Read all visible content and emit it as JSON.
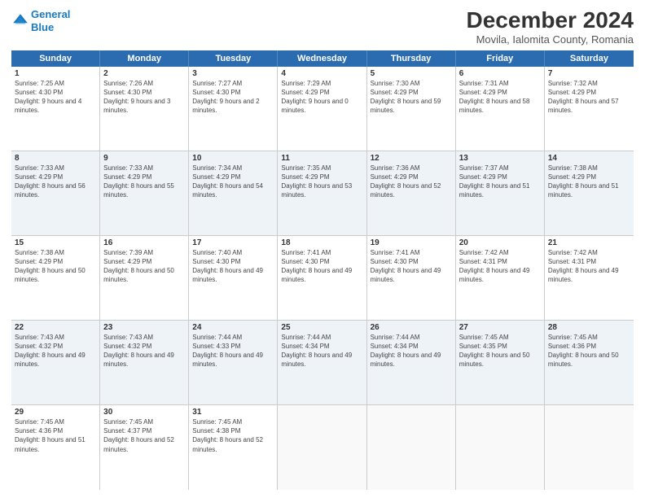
{
  "logo": {
    "line1": "General",
    "line2": "Blue"
  },
  "title": "December 2024",
  "subtitle": "Movila, Ialomita County, Romania",
  "days_of_week": [
    "Sunday",
    "Monday",
    "Tuesday",
    "Wednesday",
    "Thursday",
    "Friday",
    "Saturday"
  ],
  "weeks": [
    [
      {
        "day": "1",
        "sunrise": "Sunrise: 7:25 AM",
        "sunset": "Sunset: 4:30 PM",
        "daylight": "Daylight: 9 hours and 4 minutes."
      },
      {
        "day": "2",
        "sunrise": "Sunrise: 7:26 AM",
        "sunset": "Sunset: 4:30 PM",
        "daylight": "Daylight: 9 hours and 3 minutes."
      },
      {
        "day": "3",
        "sunrise": "Sunrise: 7:27 AM",
        "sunset": "Sunset: 4:30 PM",
        "daylight": "Daylight: 9 hours and 2 minutes."
      },
      {
        "day": "4",
        "sunrise": "Sunrise: 7:29 AM",
        "sunset": "Sunset: 4:29 PM",
        "daylight": "Daylight: 9 hours and 0 minutes."
      },
      {
        "day": "5",
        "sunrise": "Sunrise: 7:30 AM",
        "sunset": "Sunset: 4:29 PM",
        "daylight": "Daylight: 8 hours and 59 minutes."
      },
      {
        "day": "6",
        "sunrise": "Sunrise: 7:31 AM",
        "sunset": "Sunset: 4:29 PM",
        "daylight": "Daylight: 8 hours and 58 minutes."
      },
      {
        "day": "7",
        "sunrise": "Sunrise: 7:32 AM",
        "sunset": "Sunset: 4:29 PM",
        "daylight": "Daylight: 8 hours and 57 minutes."
      }
    ],
    [
      {
        "day": "8",
        "sunrise": "Sunrise: 7:33 AM",
        "sunset": "Sunset: 4:29 PM",
        "daylight": "Daylight: 8 hours and 56 minutes."
      },
      {
        "day": "9",
        "sunrise": "Sunrise: 7:33 AM",
        "sunset": "Sunset: 4:29 PM",
        "daylight": "Daylight: 8 hours and 55 minutes."
      },
      {
        "day": "10",
        "sunrise": "Sunrise: 7:34 AM",
        "sunset": "Sunset: 4:29 PM",
        "daylight": "Daylight: 8 hours and 54 minutes."
      },
      {
        "day": "11",
        "sunrise": "Sunrise: 7:35 AM",
        "sunset": "Sunset: 4:29 PM",
        "daylight": "Daylight: 8 hours and 53 minutes."
      },
      {
        "day": "12",
        "sunrise": "Sunrise: 7:36 AM",
        "sunset": "Sunset: 4:29 PM",
        "daylight": "Daylight: 8 hours and 52 minutes."
      },
      {
        "day": "13",
        "sunrise": "Sunrise: 7:37 AM",
        "sunset": "Sunset: 4:29 PM",
        "daylight": "Daylight: 8 hours and 51 minutes."
      },
      {
        "day": "14",
        "sunrise": "Sunrise: 7:38 AM",
        "sunset": "Sunset: 4:29 PM",
        "daylight": "Daylight: 8 hours and 51 minutes."
      }
    ],
    [
      {
        "day": "15",
        "sunrise": "Sunrise: 7:38 AM",
        "sunset": "Sunset: 4:29 PM",
        "daylight": "Daylight: 8 hours and 50 minutes."
      },
      {
        "day": "16",
        "sunrise": "Sunrise: 7:39 AM",
        "sunset": "Sunset: 4:29 PM",
        "daylight": "Daylight: 8 hours and 50 minutes."
      },
      {
        "day": "17",
        "sunrise": "Sunrise: 7:40 AM",
        "sunset": "Sunset: 4:30 PM",
        "daylight": "Daylight: 8 hours and 49 minutes."
      },
      {
        "day": "18",
        "sunrise": "Sunrise: 7:41 AM",
        "sunset": "Sunset: 4:30 PM",
        "daylight": "Daylight: 8 hours and 49 minutes."
      },
      {
        "day": "19",
        "sunrise": "Sunrise: 7:41 AM",
        "sunset": "Sunset: 4:30 PM",
        "daylight": "Daylight: 8 hours and 49 minutes."
      },
      {
        "day": "20",
        "sunrise": "Sunrise: 7:42 AM",
        "sunset": "Sunset: 4:31 PM",
        "daylight": "Daylight: 8 hours and 49 minutes."
      },
      {
        "day": "21",
        "sunrise": "Sunrise: 7:42 AM",
        "sunset": "Sunset: 4:31 PM",
        "daylight": "Daylight: 8 hours and 49 minutes."
      }
    ],
    [
      {
        "day": "22",
        "sunrise": "Sunrise: 7:43 AM",
        "sunset": "Sunset: 4:32 PM",
        "daylight": "Daylight: 8 hours and 49 minutes."
      },
      {
        "day": "23",
        "sunrise": "Sunrise: 7:43 AM",
        "sunset": "Sunset: 4:32 PM",
        "daylight": "Daylight: 8 hours and 49 minutes."
      },
      {
        "day": "24",
        "sunrise": "Sunrise: 7:44 AM",
        "sunset": "Sunset: 4:33 PM",
        "daylight": "Daylight: 8 hours and 49 minutes."
      },
      {
        "day": "25",
        "sunrise": "Sunrise: 7:44 AM",
        "sunset": "Sunset: 4:34 PM",
        "daylight": "Daylight: 8 hours and 49 minutes."
      },
      {
        "day": "26",
        "sunrise": "Sunrise: 7:44 AM",
        "sunset": "Sunset: 4:34 PM",
        "daylight": "Daylight: 8 hours and 49 minutes."
      },
      {
        "day": "27",
        "sunrise": "Sunrise: 7:45 AM",
        "sunset": "Sunset: 4:35 PM",
        "daylight": "Daylight: 8 hours and 50 minutes."
      },
      {
        "day": "28",
        "sunrise": "Sunrise: 7:45 AM",
        "sunset": "Sunset: 4:36 PM",
        "daylight": "Daylight: 8 hours and 50 minutes."
      }
    ],
    [
      {
        "day": "29",
        "sunrise": "Sunrise: 7:45 AM",
        "sunset": "Sunset: 4:36 PM",
        "daylight": "Daylight: 8 hours and 51 minutes."
      },
      {
        "day": "30",
        "sunrise": "Sunrise: 7:45 AM",
        "sunset": "Sunset: 4:37 PM",
        "daylight": "Daylight: 8 hours and 52 minutes."
      },
      {
        "day": "31",
        "sunrise": "Sunrise: 7:45 AM",
        "sunset": "Sunset: 4:38 PM",
        "daylight": "Daylight: 8 hours and 52 minutes."
      },
      {
        "day": "",
        "sunrise": "",
        "sunset": "",
        "daylight": ""
      },
      {
        "day": "",
        "sunrise": "",
        "sunset": "",
        "daylight": ""
      },
      {
        "day": "",
        "sunrise": "",
        "sunset": "",
        "daylight": ""
      },
      {
        "day": "",
        "sunrise": "",
        "sunset": "",
        "daylight": ""
      }
    ]
  ]
}
